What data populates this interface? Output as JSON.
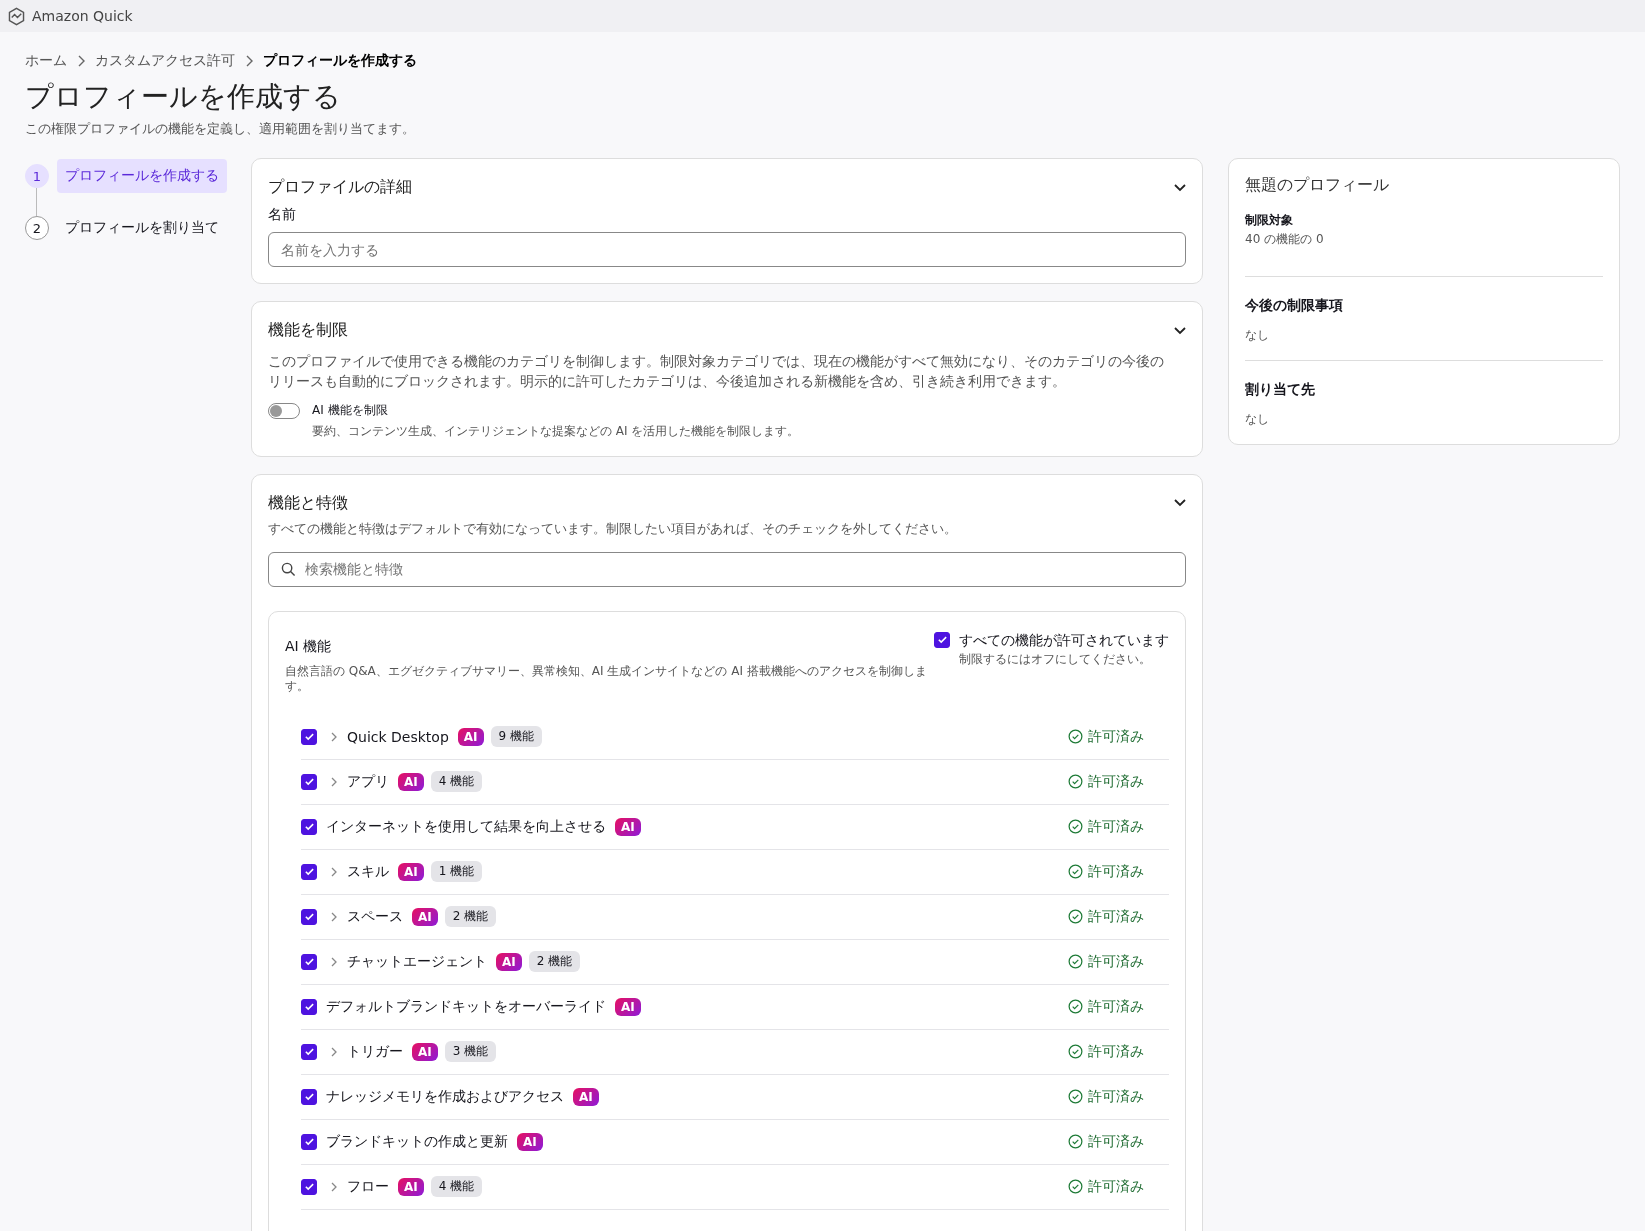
{
  "app": {
    "name": "Amazon Quick"
  },
  "breadcrumbs": [
    {
      "label": "ホーム",
      "current": false
    },
    {
      "label": "カスタムアクセス許可",
      "current": false
    },
    {
      "label": "プロフィールを作成する",
      "current": true
    }
  ],
  "page": {
    "title": "プロフィールを作成する",
    "description": "この権限プロファイルの機能を定義し、適用範囲を割り当てます。"
  },
  "steps": [
    {
      "number": "1",
      "label": "プロフィールを作成する",
      "selected": true
    },
    {
      "number": "2",
      "label": "プロフィールを割り当て",
      "selected": false
    }
  ],
  "details": {
    "title": "プロファイルの詳細",
    "expanded": true,
    "name_label": "名前",
    "name_placeholder": "名前を入力する"
  },
  "restrict": {
    "title": "機能を制限",
    "expanded": true,
    "description": "このプロファイルで使用できる機能のカテゴリを制御します。制限対象カテゴリでは、現在の機能がすべて無効になり、そのカテゴリの今後のリリースも自動的にブロックされます。明示的に許可したカテゴリは、今後追加される新機能を含め、引き続き利用できます。",
    "toggle": {
      "label": "AI 機能を制限",
      "hint": "要約、コンテンツ生成、インテリジェントな提案などの AI を活用した機能を制限します。",
      "on": false
    }
  },
  "features": {
    "title": "機能と特徴",
    "expanded": true,
    "description": "すべての機能と特徴はデフォルトで有効になっています。制限したい項目があれば、そのチェックを外してください。",
    "search_placeholder": "検索機能と特徴",
    "group": {
      "title": "AI 機能",
      "description": "自然言語の Q&A、エグゼクティブサマリー、異常検知、AI 生成インサイトなどの AI 搭載機能へのアクセスを制御します。",
      "all": {
        "label": "すべての機能が許可されています",
        "hint": "制限するにはオフにしてください。",
        "checked": true
      },
      "rows": [
        {
          "kind": "group",
          "label": "Quick Desktop",
          "badge": "AI",
          "count": "9 機能",
          "checked": true,
          "status": "許可済み"
        },
        {
          "kind": "group",
          "label": "アプリ",
          "badge": "AI",
          "count": "4 機能",
          "checked": true,
          "status": "許可済み"
        },
        {
          "kind": "item",
          "label": "インターネットを使用して結果を向上させる",
          "badge": "AI",
          "checked": true,
          "status": "許可済み"
        },
        {
          "kind": "group",
          "label": "スキル",
          "badge": "AI",
          "count": "1 機能",
          "checked": true,
          "status": "許可済み"
        },
        {
          "kind": "group",
          "label": "スペース",
          "badge": "AI",
          "count": "2 機能",
          "checked": true,
          "status": "許可済み"
        },
        {
          "kind": "group",
          "label": "チャットエージェント",
          "badge": "AI",
          "count": "2 機能",
          "checked": true,
          "status": "許可済み"
        },
        {
          "kind": "item",
          "label": "デフォルトブランドキットをオーバーライド",
          "badge": "AI",
          "checked": true,
          "status": "許可済み"
        },
        {
          "kind": "group",
          "label": "トリガー",
          "badge": "AI",
          "count": "3 機能",
          "checked": true,
          "status": "許可済み"
        },
        {
          "kind": "item",
          "label": "ナレッジメモリを作成およびアクセス",
          "badge": "AI",
          "checked": true,
          "status": "許可済み"
        },
        {
          "kind": "item",
          "label": "ブランドキットの作成と更新",
          "badge": "AI",
          "checked": true,
          "status": "許可済み"
        },
        {
          "kind": "group",
          "label": "フロー",
          "badge": "AI",
          "count": "4 機能",
          "checked": true,
          "status": "許可済み"
        }
      ]
    }
  },
  "summary": {
    "title": "無題のプロフィール",
    "sections": [
      {
        "heading": "制限対象",
        "value": "40 の機能の 0",
        "kind": "small"
      },
      {
        "heading": "今後の制限事項",
        "value": "なし",
        "kind": "large"
      },
      {
        "heading": "割り当て先",
        "value": "なし",
        "kind": "large"
      }
    ]
  }
}
